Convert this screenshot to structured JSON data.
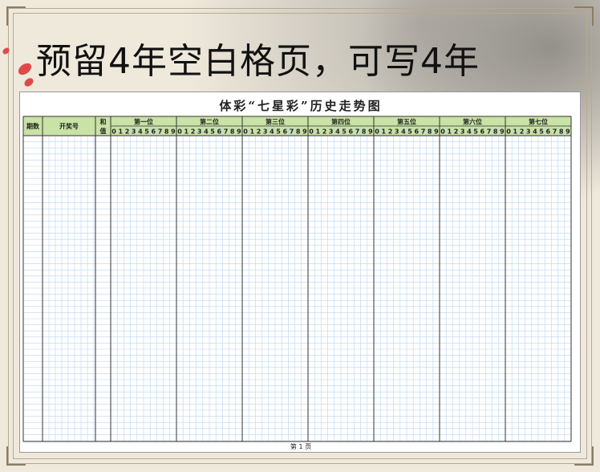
{
  "banner": {
    "text": "预留4年空白格页，可写4年"
  },
  "sheet": {
    "title": "体彩“七星彩”历史走势图",
    "headers": {
      "period": "期数",
      "draw_number": "开奖号",
      "sum_top": "和",
      "sum_bottom": "值"
    },
    "positions": [
      "第一位",
      "第二位",
      "第三位",
      "第四位",
      "第五位",
      "第六位",
      "第七位"
    ],
    "digits": [
      "0",
      "1",
      "2",
      "3",
      "4",
      "5",
      "6",
      "7",
      "8",
      "9"
    ],
    "footer": "第 1 页"
  },
  "colors": {
    "header_green": "#c9e2a6",
    "grid_blue": "#b9d4ee",
    "banner_text": "#111111",
    "petal_red": "#d93a3a"
  }
}
